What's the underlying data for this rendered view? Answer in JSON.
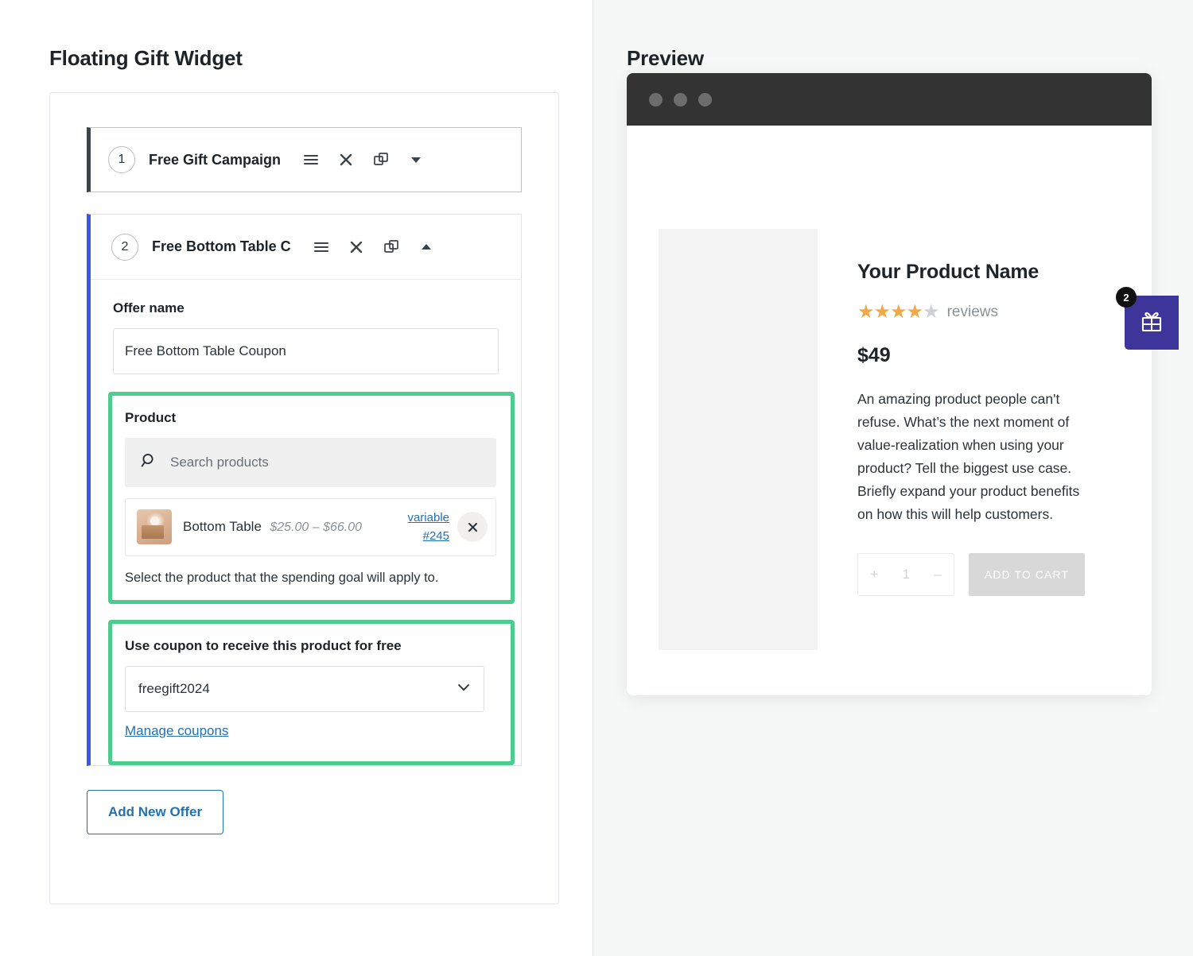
{
  "left": {
    "title": "Floating Gift Widget",
    "offers": [
      {
        "index": "1",
        "name": "Free Gift Campaign",
        "expanded": false
      },
      {
        "index": "2",
        "name": "Free Bottom Table C",
        "expanded": true,
        "offer_name_label": "Offer name",
        "offer_name_value": "Free Bottom Table Coupon",
        "product": {
          "label": "Product",
          "search_placeholder": "Search products",
          "selected": {
            "name": "Bottom Table",
            "price": "$25.00 – $66.00",
            "type_link": "variable",
            "id_link": "#245"
          },
          "helper": "Select the product that the spending goal will apply to."
        },
        "coupon": {
          "label": "Use coupon to receive this product for free",
          "value": "freegift2024",
          "manage_link": "Manage coupons"
        }
      }
    ],
    "add_offer_label": "Add New Offer"
  },
  "preview": {
    "title": "Preview",
    "product": {
      "name": "Your Product Name",
      "stars_filled": 4,
      "stars_total": 5,
      "reviews_label": "reviews",
      "price": "$49",
      "description": "An amazing product people can't refuse. What’s the next moment of value-realization when using your product? Tell the biggest use case. Briefly expand your product benefits on how this will help customers.",
      "qty_decrease": "+",
      "qty_value": "1",
      "qty_increase": "–",
      "add_to_cart_label": "ADD TO CART"
    },
    "gift_widget": {
      "badge_count": "2",
      "icon": "gift-icon"
    }
  },
  "colors": {
    "accent_blue": "#3858e9",
    "link_blue": "#2271b1",
    "highlight_green": "#4ecb8f",
    "widget_purple": "#3d3599",
    "star_orange": "#f3a847",
    "browser_bar": "#333333"
  }
}
